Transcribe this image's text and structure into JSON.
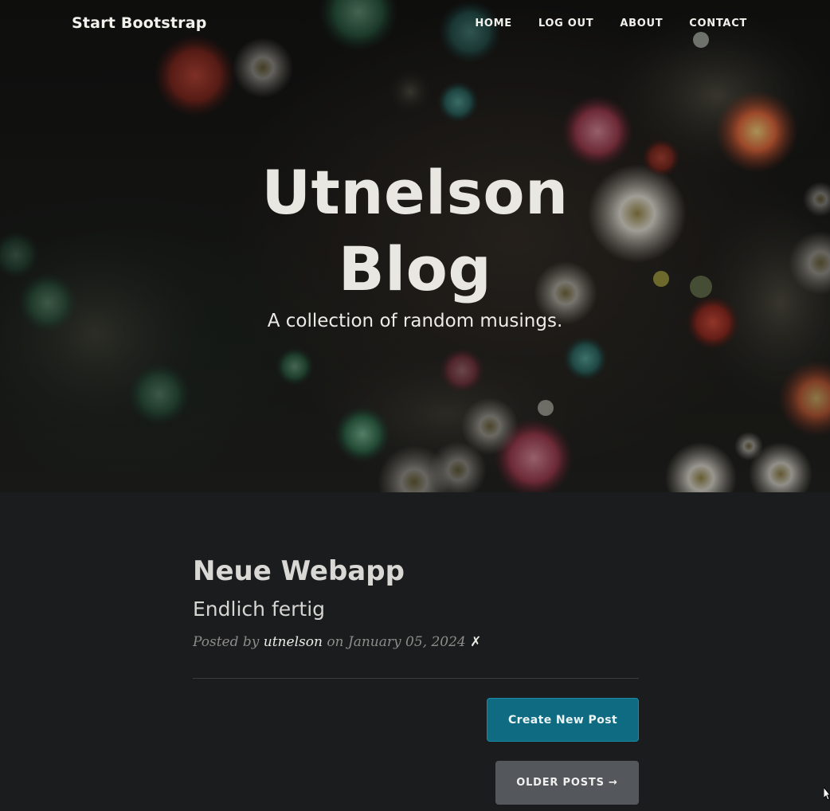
{
  "nav": {
    "brand": "Start Bootstrap",
    "links": [
      "HOME",
      "LOG OUT",
      "ABOUT",
      "CONTACT"
    ]
  },
  "hero": {
    "title": "Utnelson Blog",
    "subtitle": "A collection of random musings."
  },
  "post": {
    "title": "Neue Webapp",
    "subtitle": "Endlich fertig",
    "meta_prefix": "Posted by ",
    "author": "utnelson",
    "meta_middle": " on January 05, 2024 ",
    "delete_symbol": "✗"
  },
  "buttons": {
    "create": "Create New Post",
    "older": "OLDER POSTS →"
  },
  "colors": {
    "page_background": "#1b1c1e",
    "create_button": "#0e6b82",
    "older_button": "#54585d"
  },
  "icons": {
    "delete": "delete-icon",
    "cursor": "mouse-cursor-icon"
  }
}
